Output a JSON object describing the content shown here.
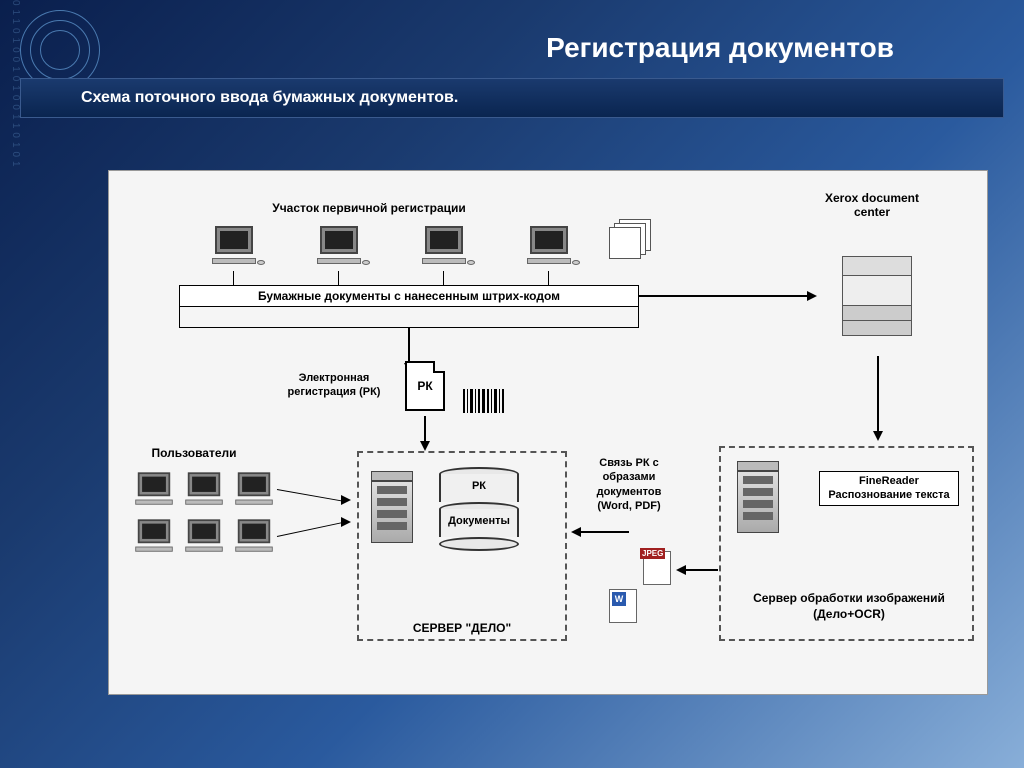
{
  "title": "Регистрация документов",
  "subtitle": "Схема поточного ввода бумажных документов.",
  "diagram": {
    "primary_reg_section": "Участок первичной регистрации",
    "xerox_label": "Xerox document center",
    "barcode_bar": "Бумажные документы с нанесенным штрих-кодом",
    "electronic_reg": "Электронная регистрация (РК)",
    "rk_doc": "РК",
    "users_label": "Пользователи",
    "db_rk": "РК",
    "db_docs": "Документы",
    "server_delo": "СЕРВЕР \"ДЕЛО\"",
    "link_label": "Связь РК с образами документов (Word, PDF)",
    "finereader": "FineReader Распознование текста",
    "ocr_server": "Сервер обработки изображений (Дело+OCR)",
    "jpeg": "JPEG",
    "word": "W"
  }
}
